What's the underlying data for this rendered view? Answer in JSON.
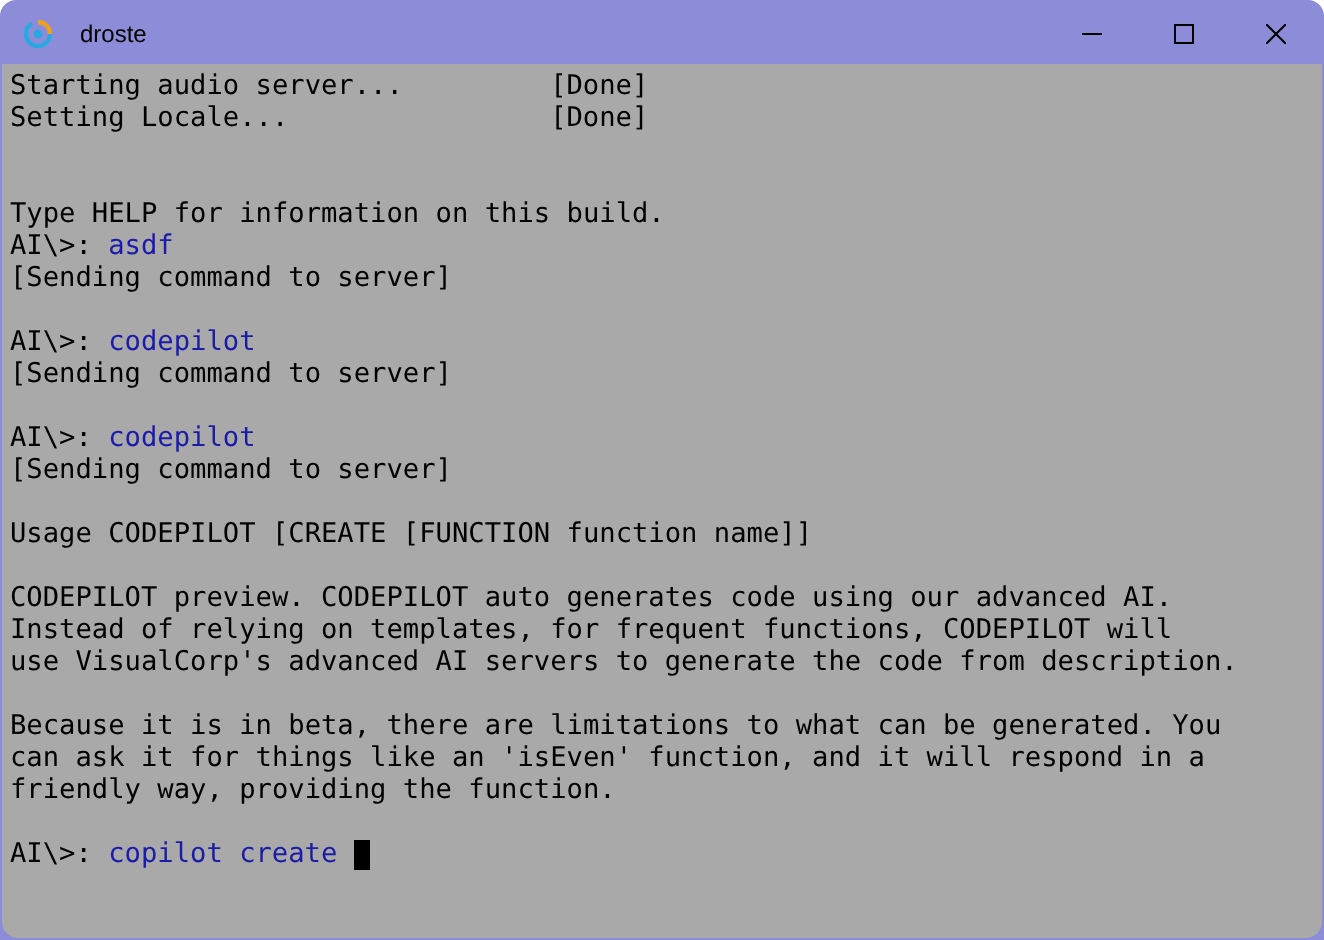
{
  "window": {
    "title": "droste"
  },
  "terminal": {
    "lines": [
      {
        "kind": "status",
        "label": "Starting audio server...",
        "status": "[Done]"
      },
      {
        "kind": "status",
        "label": "Setting Locale...",
        "status": "[Done]"
      },
      {
        "kind": "blank"
      },
      {
        "kind": "blank"
      },
      {
        "kind": "output",
        "text": "Type HELP for information on this build."
      },
      {
        "kind": "prompt",
        "prompt": "AI\\>:",
        "command": "asdf"
      },
      {
        "kind": "output",
        "text": "[Sending command to server]"
      },
      {
        "kind": "blank"
      },
      {
        "kind": "prompt",
        "prompt": "AI\\>:",
        "command": "codepilot"
      },
      {
        "kind": "output",
        "text": "[Sending command to server]"
      },
      {
        "kind": "blank"
      },
      {
        "kind": "prompt",
        "prompt": "AI\\>:",
        "command": "codepilot"
      },
      {
        "kind": "output",
        "text": "[Sending command to server]"
      },
      {
        "kind": "blank"
      },
      {
        "kind": "output",
        "text": "Usage CODEPILOT [CREATE [FUNCTION function name]]"
      },
      {
        "kind": "blank"
      },
      {
        "kind": "output",
        "text": "CODEPILOT preview. CODEPILOT auto generates code using our advanced AI."
      },
      {
        "kind": "output",
        "text": "Instead of relying on templates, for frequent functions, CODEPILOT will"
      },
      {
        "kind": "output",
        "text": "use VisualCorp's advanced AI servers to generate the code from description."
      },
      {
        "kind": "blank"
      },
      {
        "kind": "output",
        "text": "Because it is in beta, there are limitations to what can be generated. You"
      },
      {
        "kind": "output",
        "text": "can ask it for things like an 'isEven' function, and it will respond in a"
      },
      {
        "kind": "output",
        "text": "friendly way, providing the function."
      },
      {
        "kind": "blank"
      },
      {
        "kind": "prompt",
        "prompt": "AI\\>:",
        "command": "copilot create",
        "cursor": true
      }
    ]
  }
}
